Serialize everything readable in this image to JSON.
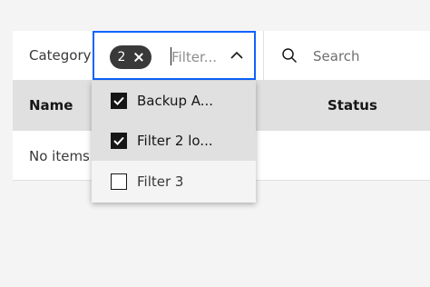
{
  "toolbar": {
    "category_label": "Category",
    "selected_count": "2",
    "filter_placeholder": "Filter...",
    "search_placeholder": "Search"
  },
  "table": {
    "columns": [
      "Name",
      "Status"
    ],
    "empty_text": "No items"
  },
  "dropdown": {
    "options": [
      {
        "label": "Backup A...",
        "checked": true
      },
      {
        "label": "Filter 2 lo...",
        "checked": true
      },
      {
        "label": "Filter 3",
        "checked": false
      }
    ]
  },
  "colors": {
    "focus_border": "#0f62fe",
    "tag_background": "#393939",
    "header_background": "#e0e0e0",
    "page_background": "#f4f4f4"
  }
}
